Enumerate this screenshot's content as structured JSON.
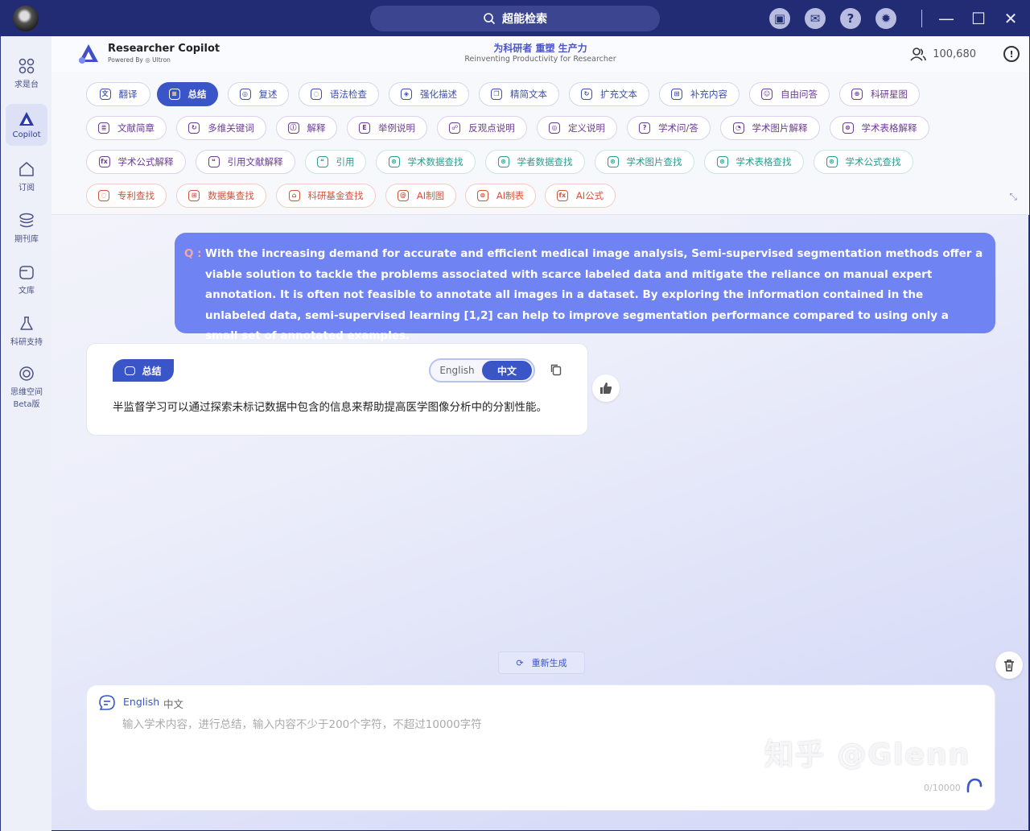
{
  "titlebar": {
    "search_label": "超能检索"
  },
  "sidebar": {
    "items": [
      {
        "label": "求是台"
      },
      {
        "label": "Copilot"
      },
      {
        "label": "订阅"
      },
      {
        "label": "期刊库"
      },
      {
        "label": "文库"
      },
      {
        "label": "科研支持"
      },
      {
        "label": "思维空间",
        "label2": "Beta版"
      }
    ]
  },
  "header": {
    "brand_title": "Researcher Copilot",
    "brand_sub": "Powered By ◎ Ultron",
    "slogan_cn": "为科研者 重塑 生产力",
    "slogan_en": "Reinventing Productivity for Researcher",
    "points": "100,680"
  },
  "tools": {
    "row1": [
      "翻译",
      "总结",
      "复述",
      "语法检查",
      "强化描述",
      "精简文本",
      "扩充文本",
      "补充内容",
      "自由问答",
      "科研星图"
    ],
    "row2": [
      "文献简章",
      "多维关键词",
      "解释",
      "举例说明",
      "反观点说明",
      "定义说明",
      "学术问/答",
      "学术图片解释",
      "学术表格解释"
    ],
    "row3": [
      "学术公式解释",
      "引用文献解释",
      "引用",
      "学术数据查找",
      "学者数据查找",
      "学术图片查找",
      "学术表格查找",
      "学术公式查找"
    ],
    "row4": [
      "专利查找",
      "数据集查找",
      "科研基金查找",
      "AI制图",
      "AI制表",
      "AI公式"
    ]
  },
  "question": {
    "label": "Q :",
    "text": "With the increasing demand for accurate and efficient medical image analysis, Semi-supervised segmentation methods offer a viable solution to tackle the problems associated with scarce labeled data and mitigate the reliance on manual expert annotation. It is often not feasible to annotate all images in a dataset. By exploring the information contained in the unlabeled data, semi-supervised learning [1,2] can help to improve segmentation performance compared to using only a small set of annotated examples."
  },
  "answer": {
    "tag": "总结",
    "lang_en": "English",
    "lang_cn": "中文",
    "text": "半监督学习可以通过探索未标记数据中包含的信息来帮助提高医学图像分析中的分割性能。"
  },
  "regen_label": "重新生成",
  "input": {
    "lang_en": "English",
    "lang_cn": "中文",
    "placeholder": "输入学术内容，进行总结，输入内容不少于200个字符，不超过10000字符",
    "counter": "0/10000"
  },
  "watermark": "知乎 @Glenn",
  "colors": {
    "accent": "#3a55c8",
    "question_bg": "#7083f2",
    "titlebar": "#222c75"
  }
}
